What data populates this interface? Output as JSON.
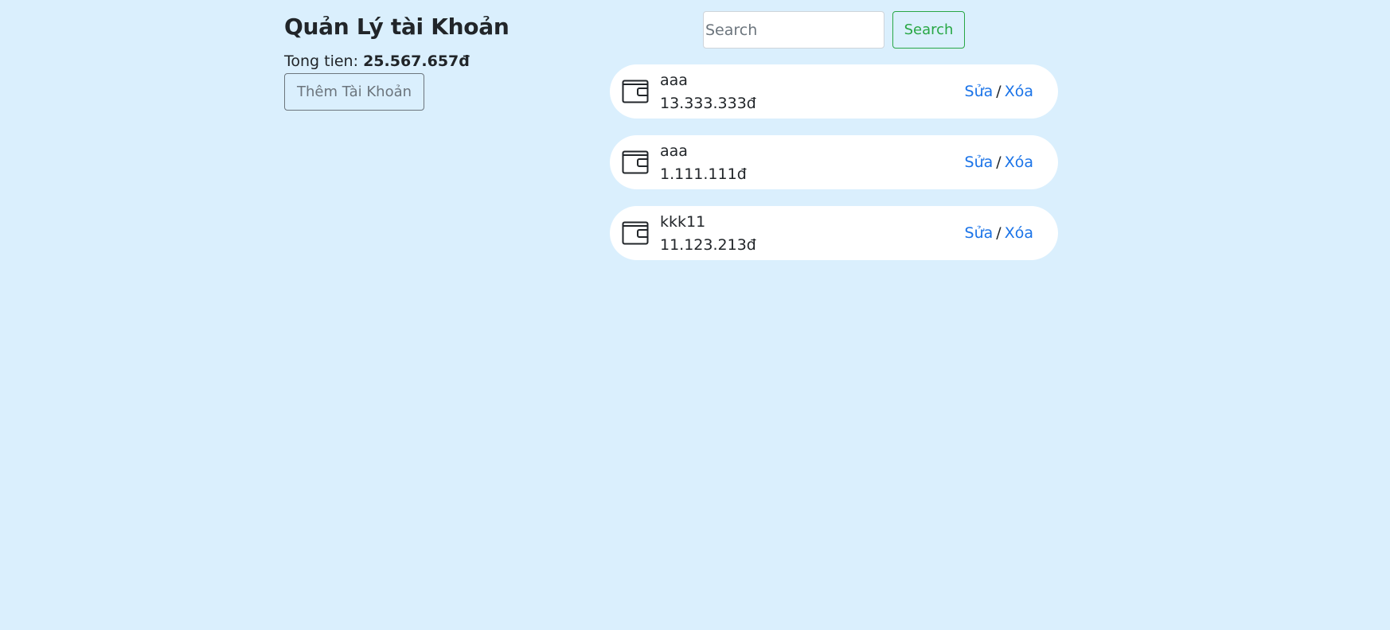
{
  "header": {
    "title": "Quản Lý tài Khoản",
    "total_label": "Tong tien:",
    "total_value": "25.567.657đ",
    "add_button_label": "Thêm Tài Khoản"
  },
  "search": {
    "placeholder": "Search",
    "value": "",
    "button_label": "Search"
  },
  "accounts": [
    {
      "name": "aaa",
      "balance": "13.333.333đ",
      "edit_label": "Sửa",
      "separator": "/",
      "delete_label": "Xóa",
      "icon": "wallet-icon"
    },
    {
      "name": "aaa",
      "balance": "1.111.111đ",
      "edit_label": "Sửa",
      "separator": "/",
      "delete_label": "Xóa",
      "icon": "wallet-icon"
    },
    {
      "name": "kkk11",
      "balance": "11.123.213đ",
      "edit_label": "Sửa",
      "separator": "/",
      "delete_label": "Xóa",
      "icon": "wallet-icon"
    }
  ],
  "colors": {
    "background": "#daeffd",
    "card": "#ffffff",
    "link": "#1a73e8",
    "search_button": "#28a745",
    "add_button": "#6c757d",
    "text": "#212529"
  }
}
